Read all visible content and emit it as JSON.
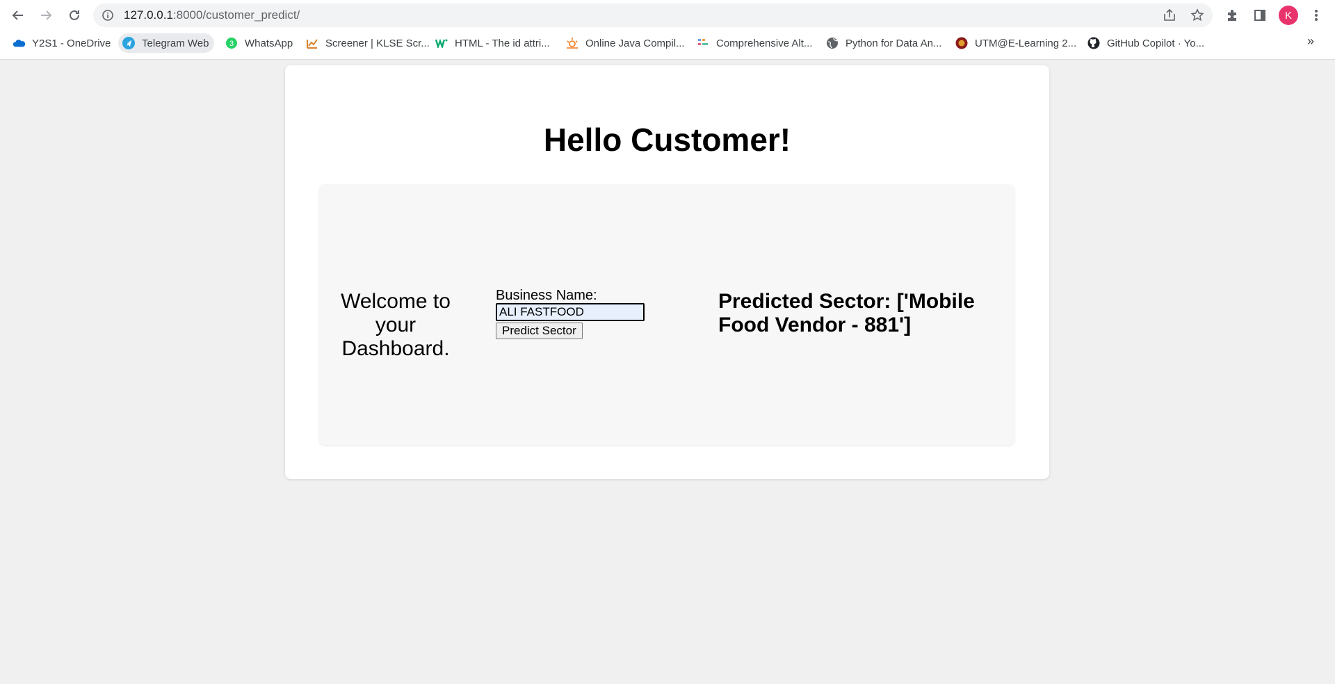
{
  "browser": {
    "url_host": "127.0.0.1",
    "url_rest": ":8000/customer_predict/",
    "profile_initial": "K",
    "accent": "#e8336d",
    "bookmarks": [
      {
        "label": "Y2S1 - OneDrive",
        "icon": "onedrive-icon"
      },
      {
        "label": "Telegram Web",
        "icon": "telegram-icon"
      },
      {
        "label": "WhatsApp",
        "icon": "whatsapp-icon"
      },
      {
        "label": "Screener | KLSE Scr...",
        "icon": "screener-icon"
      },
      {
        "label": "HTML - The id attri...",
        "icon": "w3schools-icon"
      },
      {
        "label": "Online Java Compil...",
        "icon": "java-compiler-icon"
      },
      {
        "label": "Comprehensive Alt...",
        "icon": "altair-icon"
      },
      {
        "label": "Python for Data An...",
        "icon": "globe-icon"
      },
      {
        "label": "UTM@E-Learning 2...",
        "icon": "utm-icon"
      },
      {
        "label": "GitHub Copilot · Yo...",
        "icon": "github-icon"
      }
    ],
    "more_bookmarks": "»",
    "whatsapp_badge": "3"
  },
  "page": {
    "title": "Hello Customer!",
    "welcome": "Welcome to your Dashboard.",
    "form": {
      "label": "Business Name:",
      "value": "ALI FASTFOOD",
      "button": "Predict Sector"
    },
    "result": "Predicted Sector: ['Mobile Food Vendor - 881']"
  }
}
